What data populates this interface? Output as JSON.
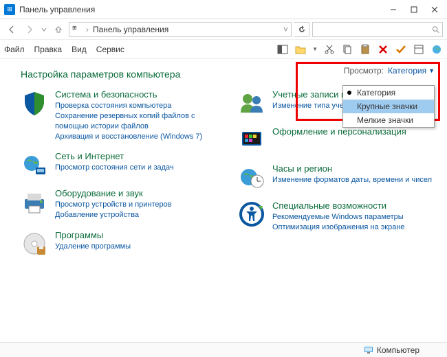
{
  "window": {
    "title": "Панель управления"
  },
  "breadcrumb": {
    "root": "Панель управления"
  },
  "search": {
    "placeholder": ""
  },
  "menubar": {
    "file": "Файл",
    "edit": "Правка",
    "view": "Вид",
    "tools": "Сервис"
  },
  "heading": "Настройка параметров компьютера",
  "view": {
    "label": "Просмотр:",
    "current": "Категория",
    "options": [
      "Категория",
      "Крупные значки",
      "Мелкие значки"
    ],
    "selected_index": 1
  },
  "categories_left": [
    {
      "title": "Система и безопасность",
      "links": [
        "Проверка состояния компьютера",
        "Сохранение резервных копий файлов с помощью истории файлов",
        "Архивация и восстановление (Windows 7)"
      ]
    },
    {
      "title": "Сеть и Интернет",
      "links": [
        "Просмотр состояния сети и задач"
      ]
    },
    {
      "title": "Оборудование и звук",
      "links": [
        "Просмотр устройств и принтеров",
        "Добавление устройства"
      ]
    },
    {
      "title": "Программы",
      "links": [
        "Удаление программы"
      ]
    }
  ],
  "categories_right": [
    {
      "title": "Учетные записи польз",
      "links": [
        "Изменение типа учетной за"
      ]
    },
    {
      "title": "Оформление и персонализация",
      "links": []
    },
    {
      "title": "Часы и регион",
      "links": [
        "Изменение форматов даты, времени и чисел"
      ]
    },
    {
      "title": "Специальные возможности",
      "links": [
        "Рекомендуемые Windows параметры",
        "Оптимизация изображения на экране"
      ]
    }
  ],
  "statusbar": {
    "text": "Компьютер"
  }
}
